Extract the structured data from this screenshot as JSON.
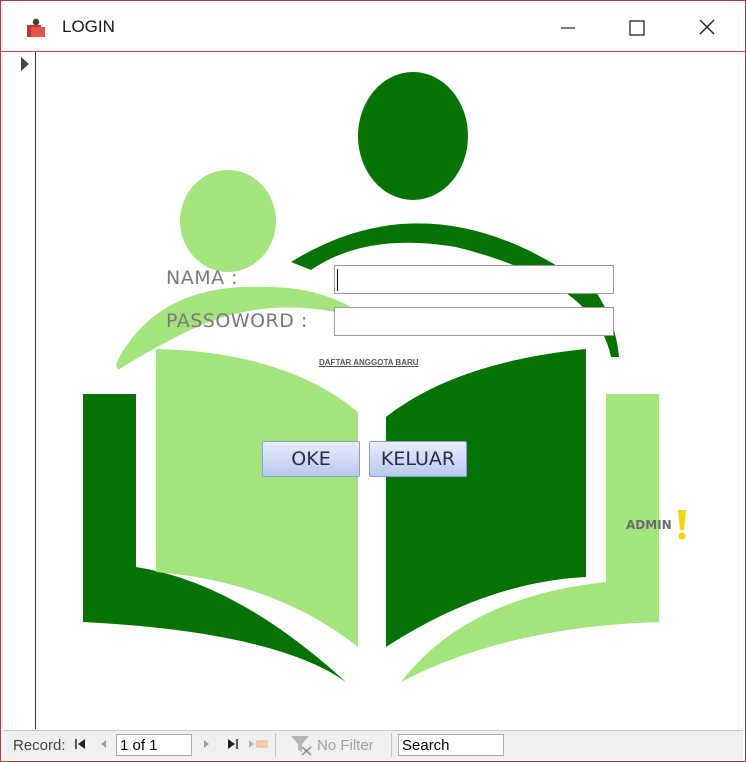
{
  "window": {
    "title": "LOGIN"
  },
  "form": {
    "nama_label": "NAMA :",
    "nama_value": "",
    "password_label": "PASSOWORD :",
    "password_value": "",
    "register_link": "DAFTAR ANGGOTA BARU",
    "ok_button": "OKE",
    "exit_button": "KELUAR",
    "admin_label": "ADMIN"
  },
  "navigation": {
    "record_label": "Record:",
    "record_position": "1 of 1",
    "filter_label": "No Filter",
    "search_value": "Search"
  },
  "colors": {
    "dark_green": "#047304",
    "light_green": "#9adc6a",
    "button_top": "#e8eefc",
    "button_bottom": "#b9c8f0",
    "window_border": "#b23b3b"
  }
}
